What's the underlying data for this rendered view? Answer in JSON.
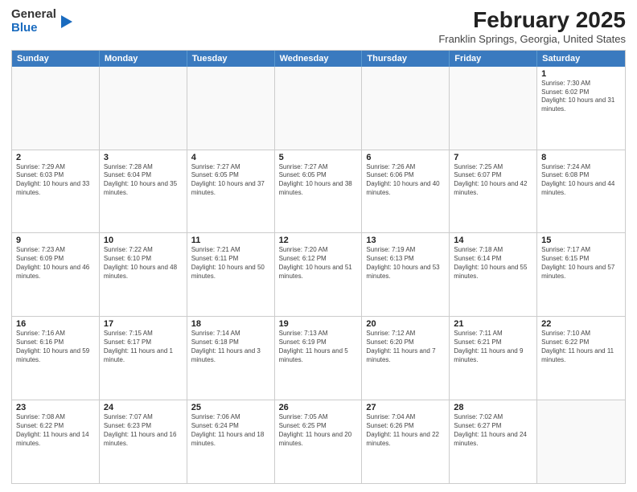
{
  "logo": {
    "general": "General",
    "blue": "Blue"
  },
  "header": {
    "month_year": "February 2025",
    "location": "Franklin Springs, Georgia, United States"
  },
  "days_of_week": [
    "Sunday",
    "Monday",
    "Tuesday",
    "Wednesday",
    "Thursday",
    "Friday",
    "Saturday"
  ],
  "rows": [
    [
      {
        "day": "",
        "info": ""
      },
      {
        "day": "",
        "info": ""
      },
      {
        "day": "",
        "info": ""
      },
      {
        "day": "",
        "info": ""
      },
      {
        "day": "",
        "info": ""
      },
      {
        "day": "",
        "info": ""
      },
      {
        "day": "1",
        "info": "Sunrise: 7:30 AM\nSunset: 6:02 PM\nDaylight: 10 hours and 31 minutes."
      }
    ],
    [
      {
        "day": "2",
        "info": "Sunrise: 7:29 AM\nSunset: 6:03 PM\nDaylight: 10 hours and 33 minutes."
      },
      {
        "day": "3",
        "info": "Sunrise: 7:28 AM\nSunset: 6:04 PM\nDaylight: 10 hours and 35 minutes."
      },
      {
        "day": "4",
        "info": "Sunrise: 7:27 AM\nSunset: 6:05 PM\nDaylight: 10 hours and 37 minutes."
      },
      {
        "day": "5",
        "info": "Sunrise: 7:27 AM\nSunset: 6:05 PM\nDaylight: 10 hours and 38 minutes."
      },
      {
        "day": "6",
        "info": "Sunrise: 7:26 AM\nSunset: 6:06 PM\nDaylight: 10 hours and 40 minutes."
      },
      {
        "day": "7",
        "info": "Sunrise: 7:25 AM\nSunset: 6:07 PM\nDaylight: 10 hours and 42 minutes."
      },
      {
        "day": "8",
        "info": "Sunrise: 7:24 AM\nSunset: 6:08 PM\nDaylight: 10 hours and 44 minutes."
      }
    ],
    [
      {
        "day": "9",
        "info": "Sunrise: 7:23 AM\nSunset: 6:09 PM\nDaylight: 10 hours and 46 minutes."
      },
      {
        "day": "10",
        "info": "Sunrise: 7:22 AM\nSunset: 6:10 PM\nDaylight: 10 hours and 48 minutes."
      },
      {
        "day": "11",
        "info": "Sunrise: 7:21 AM\nSunset: 6:11 PM\nDaylight: 10 hours and 50 minutes."
      },
      {
        "day": "12",
        "info": "Sunrise: 7:20 AM\nSunset: 6:12 PM\nDaylight: 10 hours and 51 minutes."
      },
      {
        "day": "13",
        "info": "Sunrise: 7:19 AM\nSunset: 6:13 PM\nDaylight: 10 hours and 53 minutes."
      },
      {
        "day": "14",
        "info": "Sunrise: 7:18 AM\nSunset: 6:14 PM\nDaylight: 10 hours and 55 minutes."
      },
      {
        "day": "15",
        "info": "Sunrise: 7:17 AM\nSunset: 6:15 PM\nDaylight: 10 hours and 57 minutes."
      }
    ],
    [
      {
        "day": "16",
        "info": "Sunrise: 7:16 AM\nSunset: 6:16 PM\nDaylight: 10 hours and 59 minutes."
      },
      {
        "day": "17",
        "info": "Sunrise: 7:15 AM\nSunset: 6:17 PM\nDaylight: 11 hours and 1 minute."
      },
      {
        "day": "18",
        "info": "Sunrise: 7:14 AM\nSunset: 6:18 PM\nDaylight: 11 hours and 3 minutes."
      },
      {
        "day": "19",
        "info": "Sunrise: 7:13 AM\nSunset: 6:19 PM\nDaylight: 11 hours and 5 minutes."
      },
      {
        "day": "20",
        "info": "Sunrise: 7:12 AM\nSunset: 6:20 PM\nDaylight: 11 hours and 7 minutes."
      },
      {
        "day": "21",
        "info": "Sunrise: 7:11 AM\nSunset: 6:21 PM\nDaylight: 11 hours and 9 minutes."
      },
      {
        "day": "22",
        "info": "Sunrise: 7:10 AM\nSunset: 6:22 PM\nDaylight: 11 hours and 11 minutes."
      }
    ],
    [
      {
        "day": "23",
        "info": "Sunrise: 7:08 AM\nSunset: 6:22 PM\nDaylight: 11 hours and 14 minutes."
      },
      {
        "day": "24",
        "info": "Sunrise: 7:07 AM\nSunset: 6:23 PM\nDaylight: 11 hours and 16 minutes."
      },
      {
        "day": "25",
        "info": "Sunrise: 7:06 AM\nSunset: 6:24 PM\nDaylight: 11 hours and 18 minutes."
      },
      {
        "day": "26",
        "info": "Sunrise: 7:05 AM\nSunset: 6:25 PM\nDaylight: 11 hours and 20 minutes."
      },
      {
        "day": "27",
        "info": "Sunrise: 7:04 AM\nSunset: 6:26 PM\nDaylight: 11 hours and 22 minutes."
      },
      {
        "day": "28",
        "info": "Sunrise: 7:02 AM\nSunset: 6:27 PM\nDaylight: 11 hours and 24 minutes."
      },
      {
        "day": "",
        "info": ""
      }
    ]
  ]
}
